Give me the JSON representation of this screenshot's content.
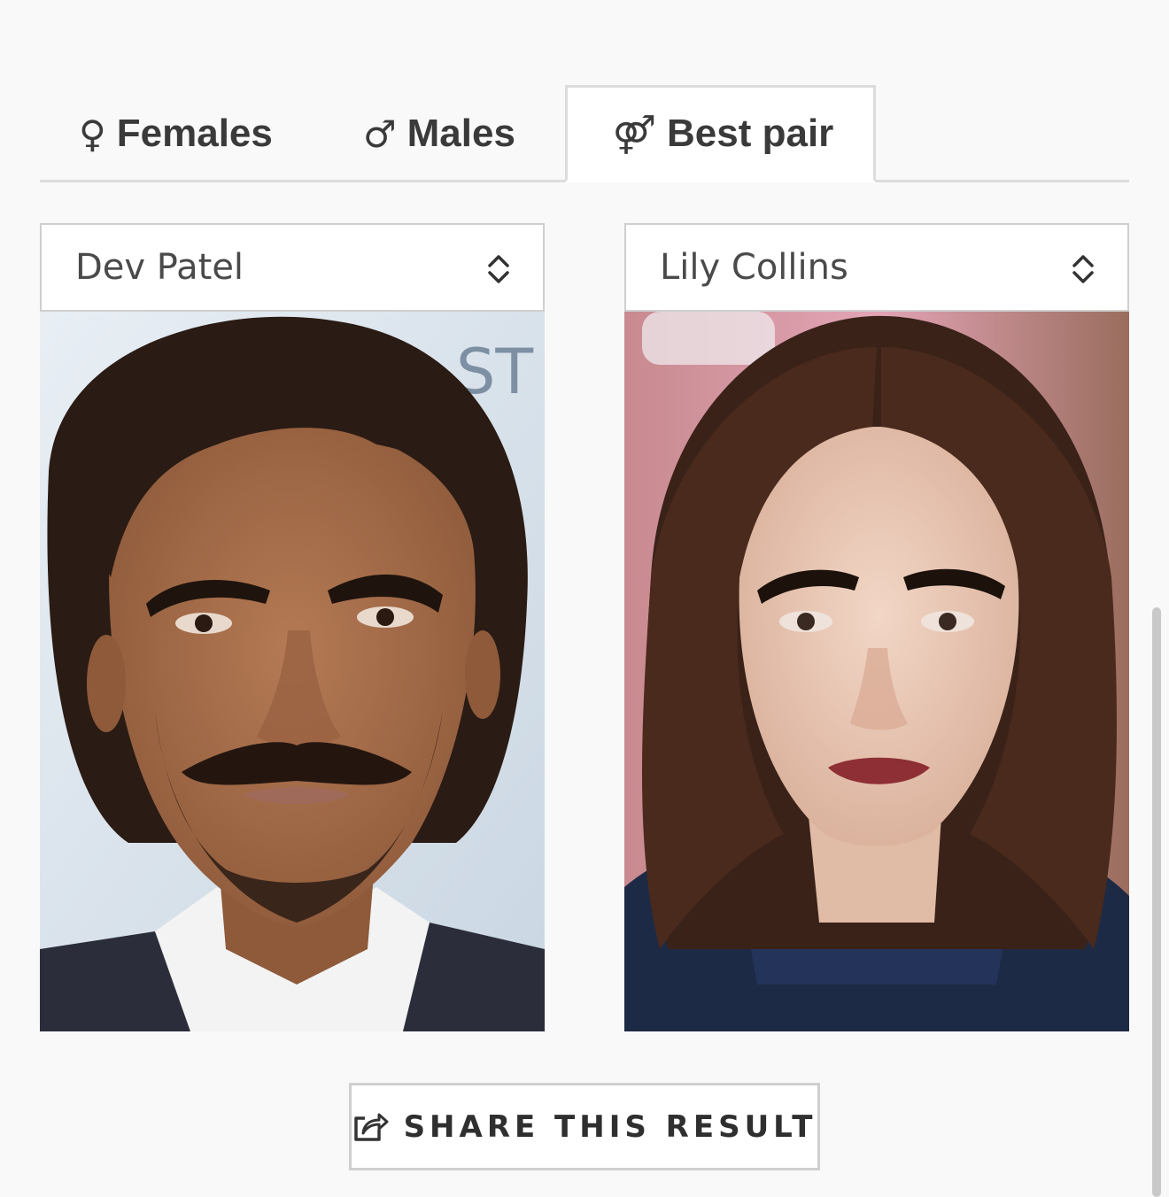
{
  "tabs": [
    {
      "label": "Females",
      "symbol": "♀",
      "active": false
    },
    {
      "label": "Males",
      "symbol": "♂",
      "active": false
    },
    {
      "label": "Best pair",
      "symbol": "⚤",
      "active": true
    }
  ],
  "left": {
    "selected": "Dev Patel",
    "photo_text": "ST"
  },
  "right": {
    "selected": "Lily Collins"
  },
  "share": {
    "label": "SHARE THIS RESULT",
    "icon": "share-icon"
  },
  "colors": {
    "background": "#f9f9f9",
    "border": "#dcdcdc",
    "text": "#3a3a3a"
  }
}
